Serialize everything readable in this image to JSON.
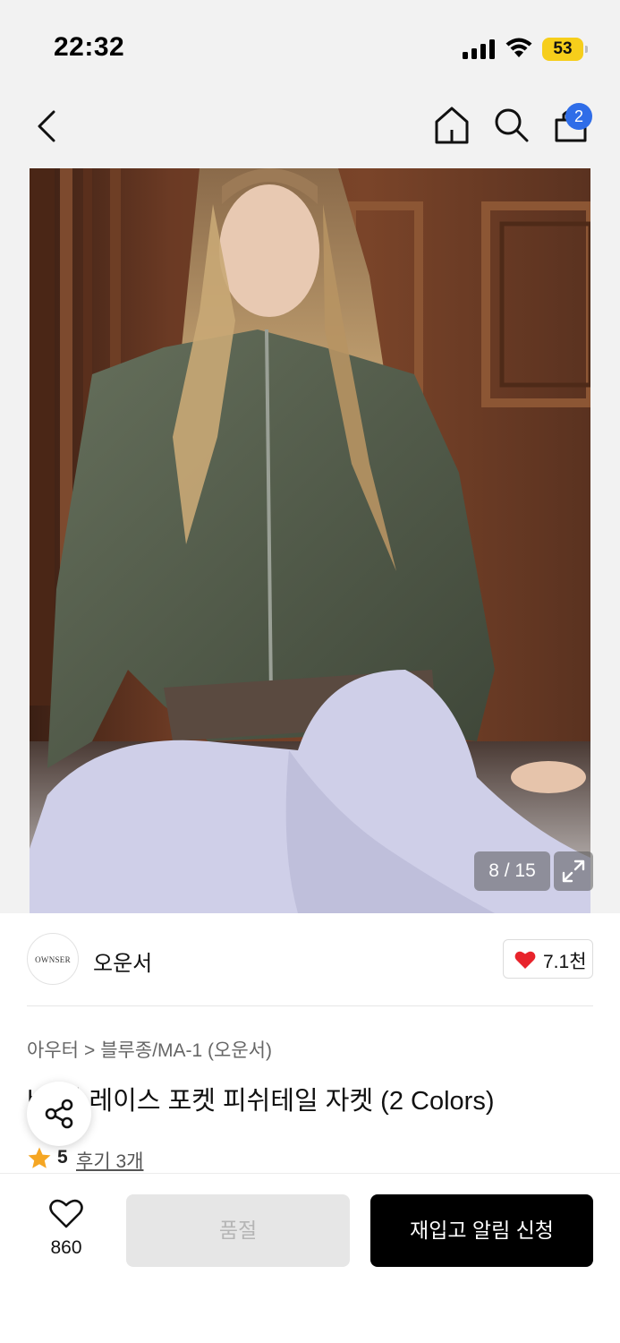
{
  "status_bar": {
    "time": "22:32",
    "battery_percent": "53",
    "icons": [
      "signal-icon",
      "wifi-icon",
      "battery-icon"
    ],
    "battery_color": "#f6ce1b"
  },
  "nav": {
    "icons": [
      "chevron-left-icon",
      "home-icon",
      "search-icon",
      "shopping-bag-icon"
    ],
    "cart_badge": "2",
    "badge_color": "#2f6de8"
  },
  "gallery": {
    "counter": "8 / 15",
    "current_index": 8,
    "total": 15,
    "expand_icon": "expand-icon"
  },
  "brand": {
    "logo_text": "OWNSER",
    "name": "오운서",
    "like_count": "7.1천",
    "like_icon": "heart-filled-icon",
    "like_color": "#e8232b"
  },
  "product": {
    "breadcrumb": [
      "아우터",
      "블루종/MA-1 (오운서)"
    ],
    "breadcrumb_separator": ">",
    "title": "바 버 레이스 포켓 피쉬테일 자켓 (2 Colors)",
    "rating": "5",
    "review_link": "후기 3개",
    "star_color": "#f5a623"
  },
  "bottom_bar": {
    "wish_count": "860",
    "soldout_label": "품절",
    "restock_label": "재입고 알림 신청"
  }
}
